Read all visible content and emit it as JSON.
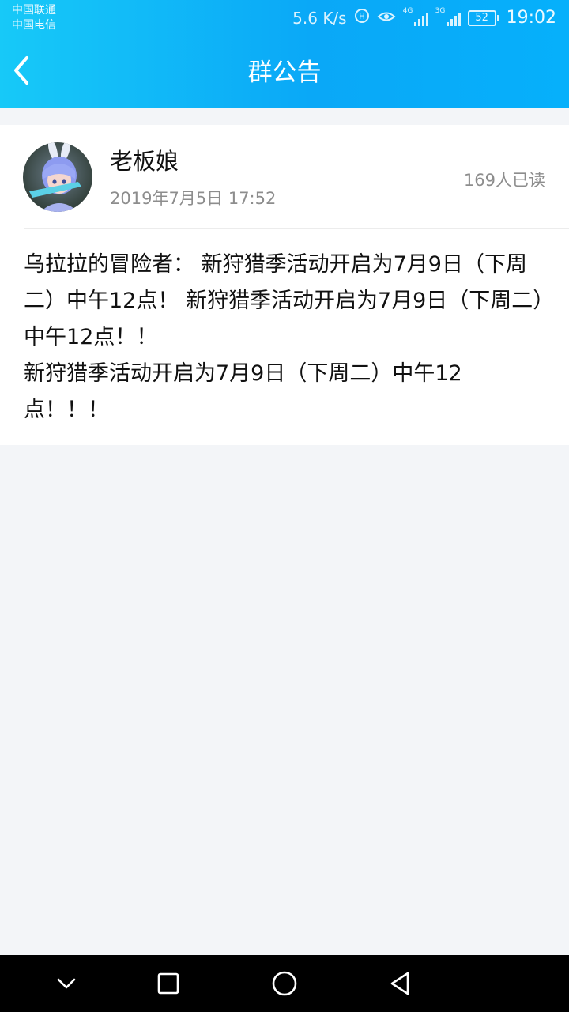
{
  "status_bar": {
    "carrier_1": "中国联通",
    "carrier_2": "中国电信",
    "network_speed": "5.6 K/s",
    "signal_1_tag": "4G",
    "signal_2_tag": "3G",
    "battery": "52",
    "time": "19:02",
    "icons": [
      "hd-call-icon",
      "eye-icon",
      "signal-icon",
      "signal-icon",
      "battery-icon"
    ]
  },
  "header": {
    "title": "群公告",
    "back_icon": "chevron-left-icon"
  },
  "announcement": {
    "author": "老板娘",
    "date": "2019年7月5日 17:52",
    "read_count": "169人已读",
    "paragraphs": [
      "乌拉拉的冒险者： 新狩猎季活动开启为7月9日（下周二）中午12点！ 新狩猎季活动开启为7月9日（下周二）中午12点！！",
      "新狩猎季活动开启为7月9日（下周二）中午12\n点！！！"
    ]
  },
  "system_nav": {
    "icons": [
      "chevron-down-icon",
      "square-icon",
      "circle-icon",
      "triangle-back-icon"
    ]
  },
  "colors": {
    "header_gradient_start": "#17c9f8",
    "header_gradient_end": "#06b0fb",
    "page_background": "#f3f5f8",
    "secondary_text": "#8d8d8d"
  }
}
